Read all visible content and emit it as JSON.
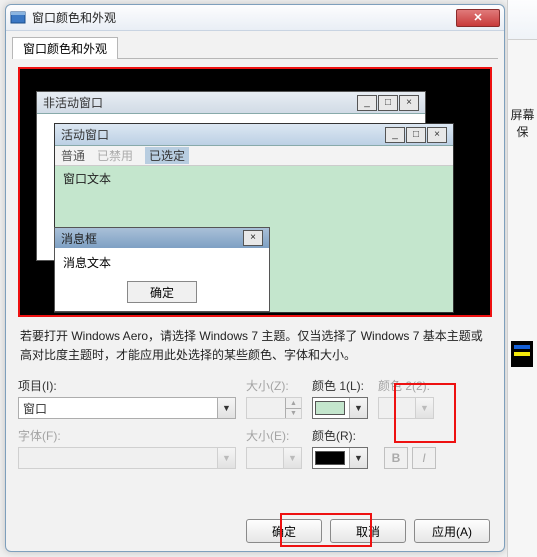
{
  "dialog": {
    "title": "窗口颜色和外观",
    "close_glyph": "✕",
    "tab": "窗口颜色和外观"
  },
  "preview": {
    "inactive_title": "非活动窗口",
    "active_title": "活动窗口",
    "menu_normal": "普通",
    "menu_disabled": "已禁用",
    "menu_selected": "已选定",
    "window_text": "窗口文本",
    "msgbox_title": "消息框",
    "msgbox_text": "消息文本",
    "msgbox_ok": "确定",
    "min_glyph": "_",
    "max_glyph": "□",
    "close_glyph": "×"
  },
  "help_text": "若要打开 Windows Aero，请选择 Windows 7 主题。仅当选择了 Windows 7 基本主题或高对比度主题时，才能应用此处选择的某些颜色、字体和大小。",
  "row1": {
    "item_label": "项目(I):",
    "item_value": "窗口",
    "size_label": "大小(Z):",
    "color1_label": "颜色 1(L):",
    "color1_value": "#c4e6cd",
    "color2_label": "颜色 2(2):"
  },
  "row2": {
    "font_label": "字体(F):",
    "size_label": "大小(E):",
    "color_label": "颜色(R):",
    "color_value": "#000000",
    "bold": "B",
    "italic": "I"
  },
  "buttons": {
    "ok": "确定",
    "cancel": "取消",
    "apply": "应用(A)"
  },
  "side": {
    "label": "屏幕保"
  }
}
